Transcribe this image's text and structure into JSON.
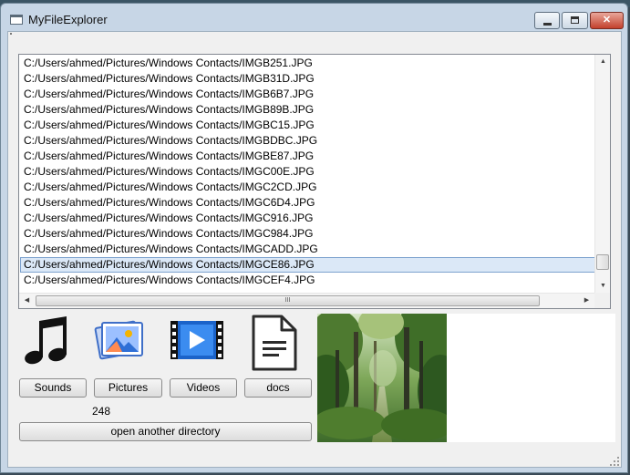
{
  "window": {
    "title": "MyFileExplorer"
  },
  "files": [
    "C:/Users/ahmed/Pictures/Windows Contacts/IMGB251.JPG",
    "C:/Users/ahmed/Pictures/Windows Contacts/IMGB31D.JPG",
    "C:/Users/ahmed/Pictures/Windows Contacts/IMGB6B7.JPG",
    "C:/Users/ahmed/Pictures/Windows Contacts/IMGB89B.JPG",
    "C:/Users/ahmed/Pictures/Windows Contacts/IMGBC15.JPG",
    "C:/Users/ahmed/Pictures/Windows Contacts/IMGBDBC.JPG",
    "C:/Users/ahmed/Pictures/Windows Contacts/IMGBE87.JPG",
    "C:/Users/ahmed/Pictures/Windows Contacts/IMGC00E.JPG",
    "C:/Users/ahmed/Pictures/Windows Contacts/IMGC2CD.JPG",
    "C:/Users/ahmed/Pictures/Windows Contacts/IMGC6D4.JPG",
    "C:/Users/ahmed/Pictures/Windows Contacts/IMGC916.JPG",
    "C:/Users/ahmed/Pictures/Windows Contacts/IMGC984.JPG",
    "C:/Users/ahmed/Pictures/Windows Contacts/IMGCADD.JPG",
    "C:/Users/ahmed/Pictures/Windows Contacts/IMGCE86.JPG",
    "C:/Users/ahmed/Pictures/Windows Contacts/IMGCEF4.JPG"
  ],
  "selected_index": 13,
  "scroll": {
    "horizontal_grip": "III"
  },
  "categories": [
    {
      "label": "Sounds",
      "icon": "music-note-icon"
    },
    {
      "label": "Pictures",
      "icon": "pictures-icon"
    },
    {
      "label": "Videos",
      "icon": "video-icon"
    },
    {
      "label": "docs",
      "icon": "document-icon"
    }
  ],
  "file_count": "248",
  "open_directory_label": "open another directory",
  "preview": {
    "image": "forest-photo"
  },
  "colors": {
    "accent_blue": "#3f7fd8",
    "selection": "#dbe8f7",
    "close_red": "#c3402c"
  }
}
